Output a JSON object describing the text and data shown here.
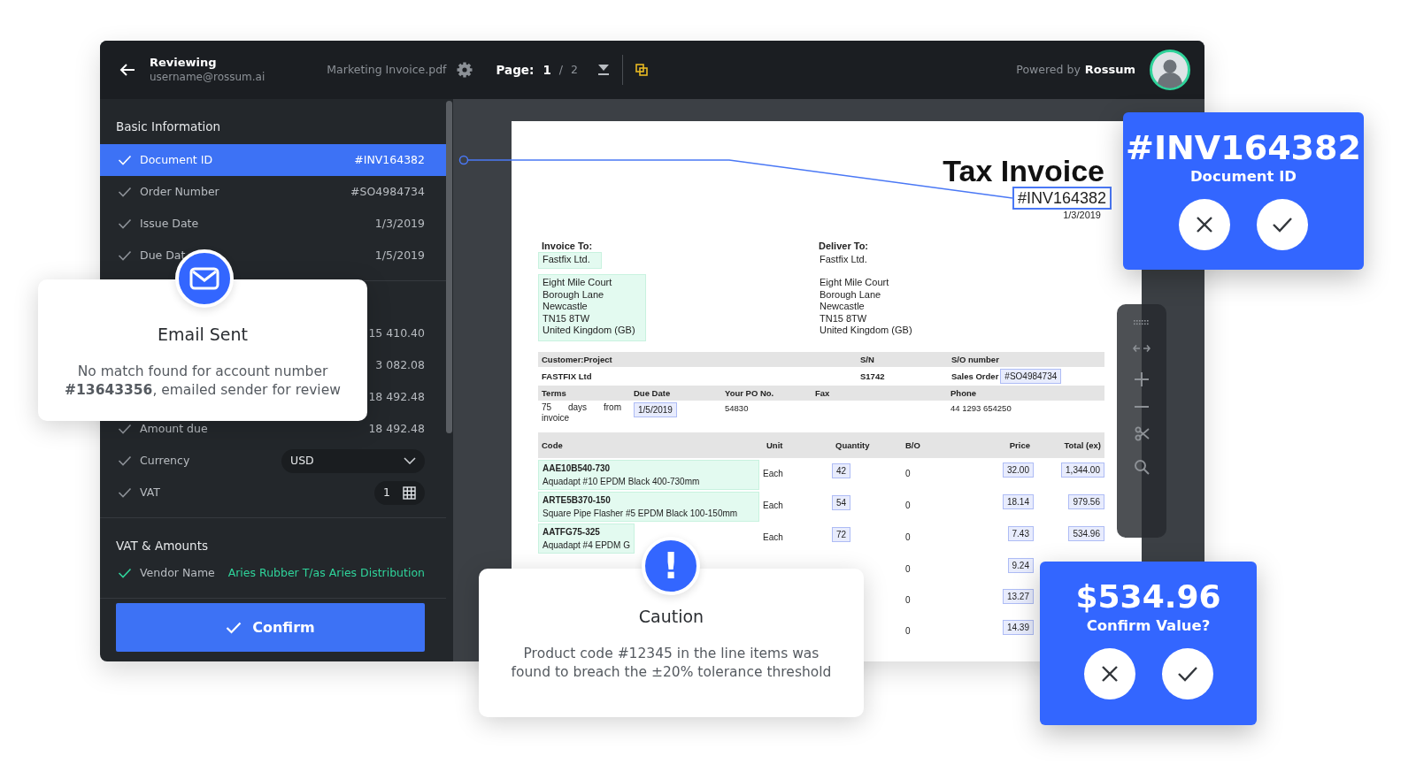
{
  "header": {
    "back_title": "Reviewing",
    "user": "username@rossum.ai",
    "file_name": "Marketing Invoice.pdf",
    "page_label": "Page:",
    "page_current": "1",
    "page_separator": "/",
    "page_total": "2",
    "powered_by": "Powered by",
    "brand": "Rossum"
  },
  "sidebar": {
    "sections": [
      {
        "title": "Basic Information",
        "fields": [
          {
            "kind": "text",
            "label": "Document ID",
            "value": "#INV164382",
            "selected": true,
            "confirmed": false
          },
          {
            "kind": "text",
            "label": "Order Number",
            "value": "#SO4984734",
            "selected": false,
            "confirmed": false
          },
          {
            "kind": "text",
            "label": "Issue Date",
            "value": "1/3/2019",
            "selected": false,
            "confirmed": false
          },
          {
            "kind": "text",
            "label": "Due Dat",
            "value": "1/5/2019",
            "selected": false,
            "confirmed": false
          }
        ]
      },
      {
        "fields": [
          {
            "kind": "text",
            "value": "15 410.40",
            "selected": false,
            "confirmed": false
          },
          {
            "kind": "text",
            "value": "3 082.08",
            "selected": false,
            "confirmed": false
          },
          {
            "kind": "text",
            "value": "18 492.48",
            "selected": false,
            "confirmed": false
          },
          {
            "kind": "text",
            "label": "Amount due",
            "value": "18 492.48",
            "selected": false,
            "confirmed": false
          },
          {
            "kind": "select",
            "label": "Currency",
            "value": "USD",
            "selected": false,
            "confirmed": false
          },
          {
            "kind": "table",
            "label": "VAT",
            "value": "1",
            "selected": false,
            "confirmed": false
          }
        ]
      },
      {
        "title": "VAT & Amounts",
        "fields": [
          {
            "kind": "text",
            "label": "Vendor Name",
            "value": "Aries Rubber T/as Aries Distribution",
            "selected": false,
            "confirmed": true
          }
        ]
      }
    ],
    "confirm_button": "Confirm"
  },
  "document": {
    "title": "Tax Invoice",
    "invoice_id": "#INV164382",
    "invoice_id_selected": true,
    "date": "1/3/2019",
    "parties": [
      {
        "heading": "Invoice To:",
        "name": "Fastfix Ltd.",
        "address": [
          "Eight Mile Court",
          "Borough Lane",
          "Newcastle",
          "TN15 8TW",
          "United Kingdom (GB)"
        ],
        "captured": true
      },
      {
        "heading": "Deliver To:",
        "name": "Fastfix Ltd.",
        "address": [
          "Eight Mile Court",
          "Borough Lane",
          "Newcastle",
          "TN15 8TW",
          "United Kingdom (GB)"
        ],
        "captured": false
      }
    ],
    "customer": {
      "headers": [
        "Customer:Project",
        "S/N",
        "S/O number"
      ],
      "project": "FASTFIX Ltd",
      "sn": "S1742",
      "so_label": "Sales Order",
      "so_value": "#SO4984734"
    },
    "terms": {
      "headers": [
        "Terms",
        "Due Date",
        "Your PO No.",
        "Fax",
        "Phone"
      ],
      "terms": "75 days from invoice",
      "due_date": "1/5/2019",
      "po": "54830",
      "phone": "44 1293 654250"
    },
    "line_items": {
      "columns": [
        "Code",
        "Unit",
        "Quantity",
        "B/O",
        "Price",
        "Total (ex)"
      ],
      "rows": [
        {
          "code": "AAE10B540-730",
          "description": "Aquadapt #10 EPDM Black 400-730mm",
          "unit": "Each",
          "quantity": "42",
          "bo": "0",
          "price": "32.00",
          "total": "1,344.00"
        },
        {
          "code": "ARTE5B370-150",
          "description": "Square Pipe Flasher #5 EPDM Black 100-150mm",
          "unit": "Each",
          "quantity": "54",
          "bo": "0",
          "price": "18.14",
          "total": "979.56"
        },
        {
          "code": "AATFG75-325",
          "description": "Aquadapt #4 EPDM G",
          "unit": "Each",
          "quantity": "72",
          "bo": "0",
          "price": "7.43",
          "total": "534.96"
        },
        {
          "bo": "0",
          "price": "9.24"
        },
        {
          "bo": "0",
          "price": "13.27"
        },
        {
          "bo": "0",
          "price": "14.39"
        }
      ]
    }
  },
  "email_popup": {
    "title": "Email Sent",
    "message": "No match found for account number **#13643356**, emailed sender for review"
  },
  "caution_popup": {
    "icon": "!",
    "title": "Caution",
    "message": "Product code #12345 in the line items was found to breach the ±20% tolerance threshold"
  },
  "document_id_card": {
    "value": "#INV164382",
    "label": "Document ID"
  },
  "value_card": {
    "value": "$534.96",
    "label": "Confirm Value?"
  }
}
